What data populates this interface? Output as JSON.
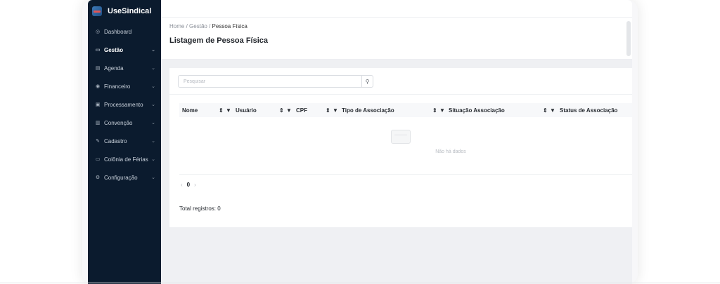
{
  "sidebar": {
    "brand": "UseSindical",
    "items": [
      {
        "label": "Dashboard",
        "icon": "◎"
      },
      {
        "label": "Gestão",
        "icon": "▭",
        "active": true,
        "chevron": "⌄"
      },
      {
        "label": "Agenda",
        "icon": "▤",
        "chevron": "⌄"
      },
      {
        "label": "Financeiro",
        "icon": "◉",
        "chevron": "⌄"
      },
      {
        "label": "Processamento",
        "icon": "▣",
        "chevron": "⌄"
      },
      {
        "label": "Convenção",
        "icon": "▥",
        "chevron": "⌄"
      },
      {
        "label": "Cadastro",
        "icon": "✎",
        "chevron": "⌄"
      },
      {
        "label": "Colônia de Férias",
        "icon": "▭",
        "chevron": "⌄"
      },
      {
        "label": "Configuração",
        "icon": "⚙",
        "chevron": "⌄"
      }
    ]
  },
  "header": {
    "breadcrumb": {
      "home": "Home",
      "sep": "/",
      "section": "Gestão",
      "current": "Pessoa Física"
    },
    "title": "Listagem de Pessoa Física"
  },
  "search": {
    "placeholder": "Pesquisar",
    "icon": "⚲"
  },
  "table": {
    "columns": [
      "Nome",
      "Usuário",
      "CPF",
      "Tipo de Associação",
      "Situação Associação",
      "Status de Associação"
    ],
    "sort_icon": "⇕",
    "filter_icon": "▼",
    "empty_text": "Não há dados"
  },
  "pagination": {
    "prev": "‹",
    "page": "0",
    "next": "›"
  },
  "footer": {
    "total": "Total registros: 0"
  }
}
